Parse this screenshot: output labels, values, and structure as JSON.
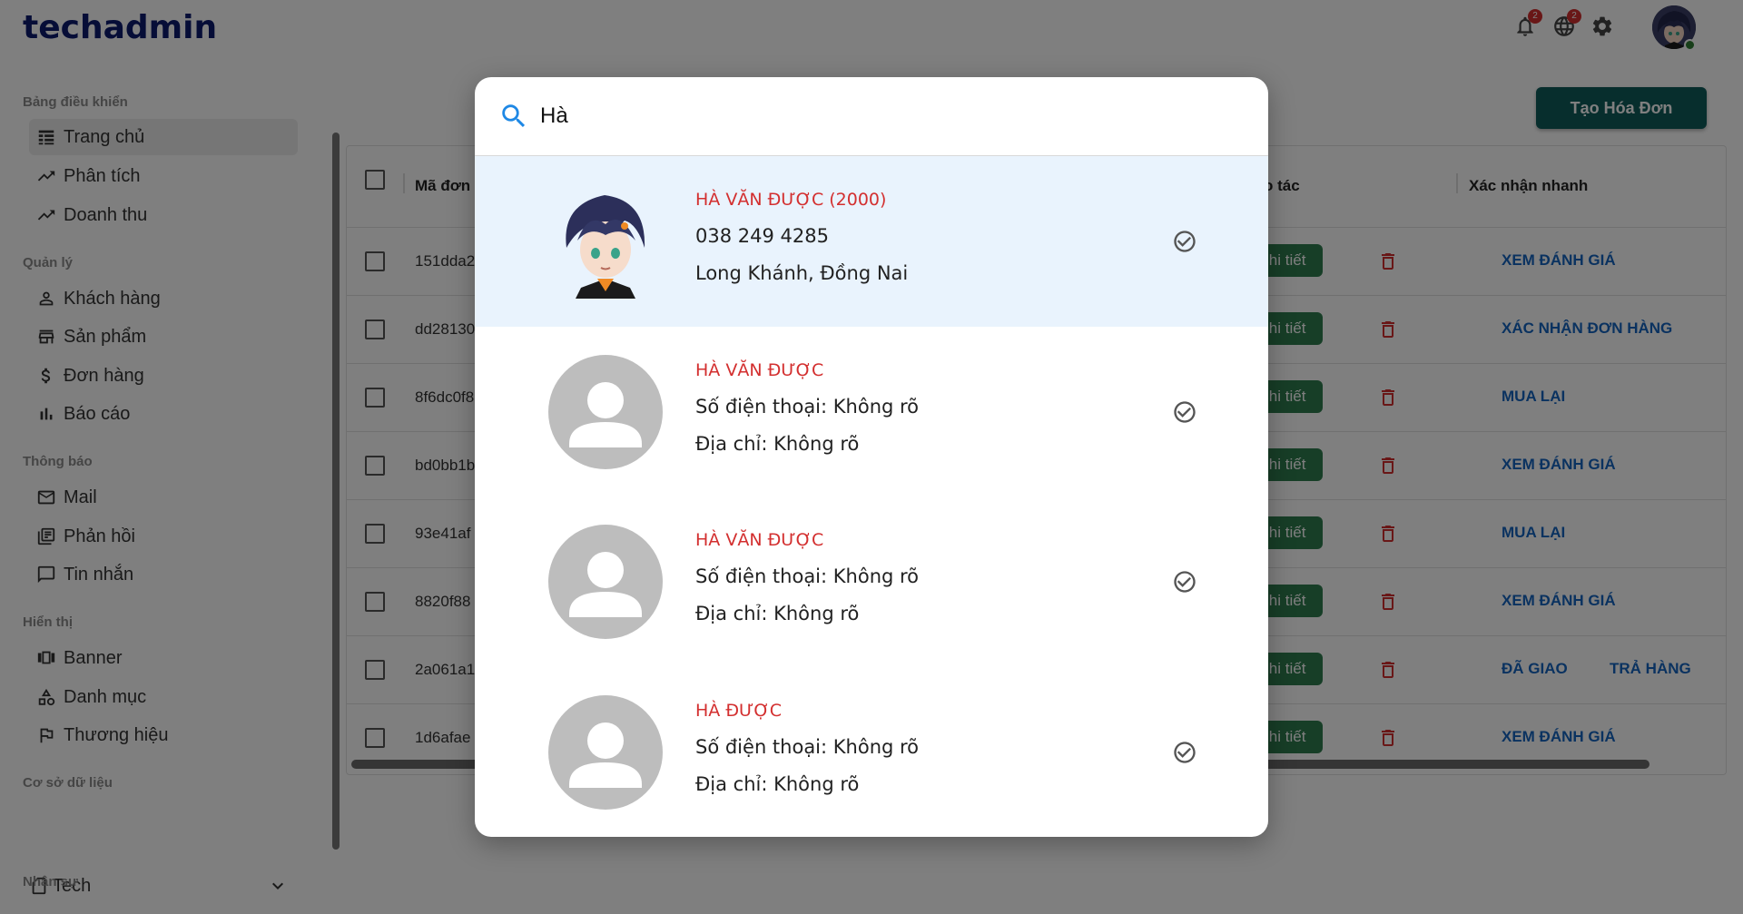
{
  "app": {
    "brand": "techadmin"
  },
  "header": {
    "notifications": {
      "icon": "bell-icon",
      "count": "2"
    },
    "language": {
      "icon": "globe-icon",
      "count": "2"
    },
    "settings": {
      "icon": "gear-icon"
    },
    "avatar": {
      "icon": "user-avatar"
    }
  },
  "sidebar": {
    "sections": [
      {
        "title": "Bảng điều khiển",
        "items": [
          {
            "label": "Trang chủ",
            "icon": "table-icon",
            "active": true
          },
          {
            "label": "Phân tích",
            "icon": "trending-up-icon"
          },
          {
            "label": "Doanh thu",
            "icon": "trending-up-icon"
          }
        ]
      },
      {
        "title": "Quản lý",
        "items": [
          {
            "label": "Khách hàng",
            "icon": "person-icon"
          },
          {
            "label": "Sản phẩm",
            "icon": "store-icon"
          },
          {
            "label": "Đơn hàng",
            "icon": "dollar-icon"
          },
          {
            "label": "Báo cáo",
            "icon": "bar-chart-icon"
          }
        ]
      },
      {
        "title": "Thông báo",
        "items": [
          {
            "label": "Mail",
            "icon": "mail-icon"
          },
          {
            "label": "Phản hồi",
            "icon": "feedback-icon"
          },
          {
            "label": "Tin nhắn",
            "icon": "chat-icon"
          }
        ]
      },
      {
        "title": "Hiển thị",
        "items": [
          {
            "label": "Banner",
            "icon": "carousel-icon"
          },
          {
            "label": "Danh mục",
            "icon": "category-icon"
          },
          {
            "label": "Thương hiệu",
            "icon": "flag-icon"
          }
        ]
      },
      {
        "title": "Cơ sở dữ liệu",
        "select_value": "Tech"
      },
      {
        "title": "Nhân sự"
      }
    ]
  },
  "main": {
    "create_button": "Tạo Hóa Đơn",
    "table": {
      "columns": [
        "Mã đơn",
        "o tác",
        "Xác nhận nhanh"
      ],
      "detail_label": "Chi tiết",
      "rows": [
        {
          "id": "151dda2",
          "actions": [
            "XEM ĐÁNH GIÁ"
          ]
        },
        {
          "id": "dd28130",
          "actions": [
            "XÁC NHẬN ĐƠN HÀNG"
          ]
        },
        {
          "id": "8f6dc0f8",
          "actions": [
            "MUA LẠI"
          ]
        },
        {
          "id": "bd0bb1b",
          "actions": [
            "XEM ĐÁNH GIÁ"
          ]
        },
        {
          "id": "93e41af",
          "actions": [
            "MUA LẠI"
          ]
        },
        {
          "id": "8820f88",
          "actions": [
            "XEM ĐÁNH GIÁ"
          ]
        },
        {
          "id": "2a061a1",
          "actions": [
            "ĐÃ GIAO",
            "TRẢ HÀNG"
          ]
        },
        {
          "id": "1d6afae",
          "actions": [
            "XEM ĐÁNH GIÁ"
          ]
        }
      ]
    }
  },
  "modal": {
    "search": {
      "value": "Hà",
      "icon": "search-icon"
    },
    "results": [
      {
        "name": "HÀ VĂN ĐƯỢC (2000)",
        "line1": "038 249 4285",
        "line2": "Long Khánh, Đồng Nai",
        "avatar": "anime-avatar",
        "selected": true
      },
      {
        "name": "HÀ VĂN ĐƯỢC",
        "line1": "Số điện thoại: Không rõ",
        "line2": "Địa chỉ: Không rõ",
        "avatar": "default-person-avatar"
      },
      {
        "name": "HÀ VĂN ĐƯỢC",
        "line1": "Số điện thoại: Không rõ",
        "line2": "Địa chỉ: Không rõ",
        "avatar": "default-person-avatar"
      },
      {
        "name": "HÀ ĐƯỢC",
        "line1": "Số điện thoại: Không rõ",
        "line2": "Địa chỉ: Không rõ",
        "avatar": "default-person-avatar"
      }
    ]
  },
  "colors": {
    "brand": "#0d1b6e",
    "accent": "#1e88e5",
    "name_red": "#d32f2f",
    "create_btn": "#0f5c5a",
    "detail_btn": "#2e7d4f",
    "link_blue": "#1565c0"
  }
}
